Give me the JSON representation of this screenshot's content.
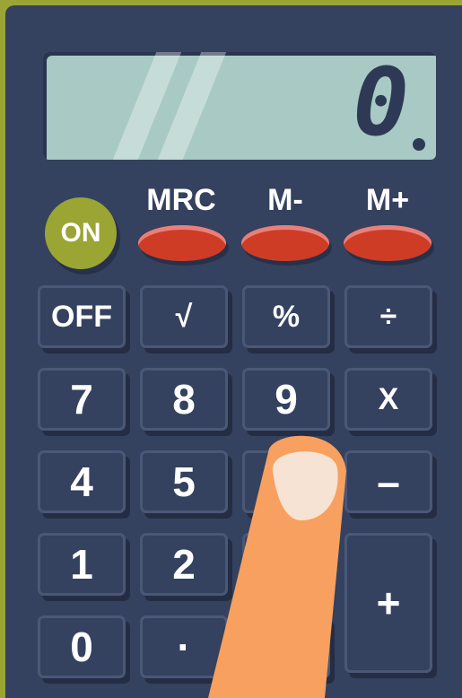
{
  "display": {
    "value": "0"
  },
  "power": {
    "on_label": "ON"
  },
  "memory": [
    {
      "label": "MRC"
    },
    {
      "label": "M-"
    },
    {
      "label": "M+"
    }
  ],
  "keys": {
    "off": "OFF",
    "sqrt": "√",
    "percent": "%",
    "divide": "÷",
    "seven": "7",
    "eight": "8",
    "nine": "9",
    "multiply": "X",
    "four": "4",
    "five": "5",
    "minus": "–",
    "one": "1",
    "two": "2",
    "zero": "0",
    "dot": "·",
    "plus": "+"
  },
  "colors": {
    "body": "#34415f",
    "display": "#a8c9c4",
    "on_button": "#9aa534",
    "memory_button": "#cf3c25",
    "finger": "#f8a05f",
    "nail": "#f6e3d4"
  }
}
